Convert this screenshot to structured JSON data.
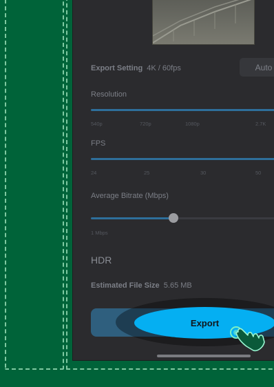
{
  "export_setting": {
    "label": "Export Setting",
    "value": "4K / 60fps",
    "auto_label": "Auto"
  },
  "resolution": {
    "label": "Resolution",
    "ticks": [
      "540p",
      "720p",
      "1080p",
      "2.7K"
    ]
  },
  "fps": {
    "label": "FPS",
    "ticks": [
      "24",
      "25",
      "30",
      "50"
    ]
  },
  "bitrate": {
    "label": "Average Bitrate (Mbps)",
    "min_label": "1 Mbps"
  },
  "hdr": {
    "label": "HDR"
  },
  "file_size": {
    "label": "Estimated File Size",
    "value": "5.65 MB"
  },
  "export_button": {
    "label": "Export"
  },
  "colors": {
    "background": "#006339",
    "panel": "#2b2b2e",
    "accent": "#05aff2",
    "slider_track": "#2e6f9b"
  },
  "icons": [
    "tap-gesture-hand-icon"
  ]
}
